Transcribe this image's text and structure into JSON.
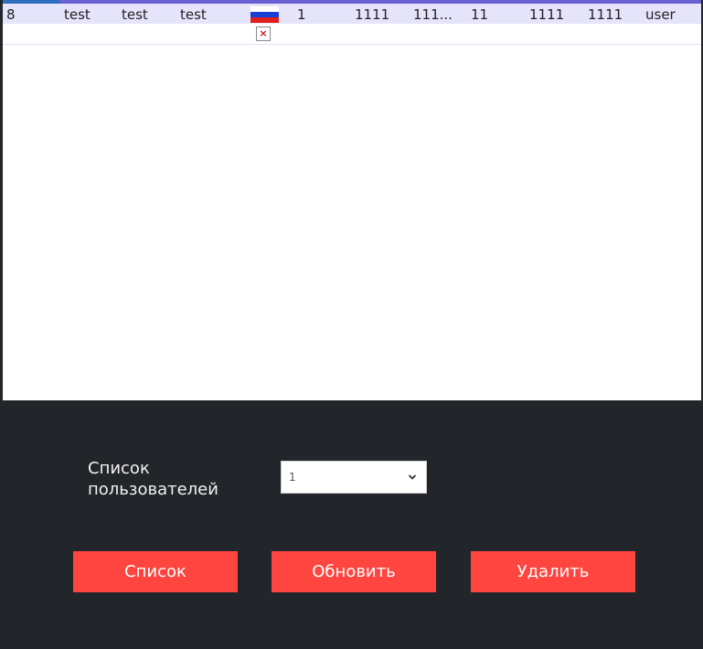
{
  "table": {
    "row": {
      "id": "8",
      "col2": "test",
      "col3": "test",
      "col4": "test",
      "col6": "1",
      "col7": "1111",
      "col8": "111...",
      "col9": "11",
      "col10": "1111",
      "col11": "1111",
      "role": "user",
      "flag_icon": "russia-flag",
      "broken_image_icon": "broken-image-icon"
    }
  },
  "controls": {
    "select_label": "Список пользователей",
    "select_value": "1",
    "buttons": {
      "list": "Список",
      "refresh": "Обновить",
      "delete": "Удалить"
    }
  },
  "colors": {
    "button": "#ff4540",
    "background": "#222529",
    "row_highlight": "#e6e4fb"
  }
}
